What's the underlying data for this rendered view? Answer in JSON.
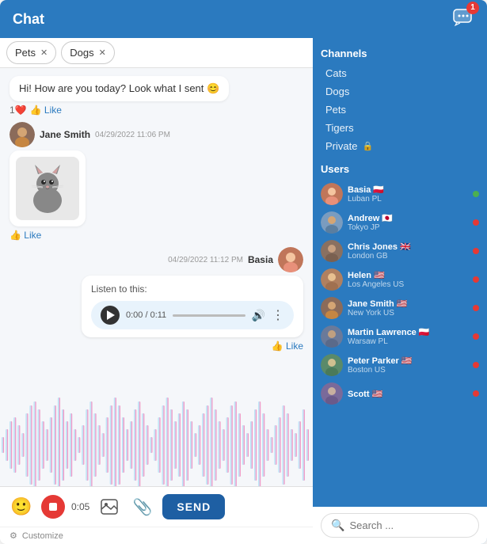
{
  "header": {
    "title": "Chat",
    "notification_count": "1"
  },
  "tabs": [
    {
      "label": "Pets",
      "active": true
    },
    {
      "label": "Dogs",
      "active": false
    }
  ],
  "channels": {
    "section_title": "Channels",
    "items": [
      {
        "name": "Cats",
        "icon": ""
      },
      {
        "name": "Dogs",
        "icon": ""
      },
      {
        "name": "Pets",
        "icon": ""
      },
      {
        "name": "Tigers",
        "icon": ""
      },
      {
        "name": "Private",
        "icon": "🔒"
      }
    ]
  },
  "users": {
    "section_title": "Users",
    "items": [
      {
        "name": "Basia",
        "flag": "🇵🇱",
        "location": "Luban PL",
        "status": "online"
      },
      {
        "name": "Andrew",
        "flag": "🇯🇵",
        "location": "Tokyo JP",
        "status": "offline"
      },
      {
        "name": "Chris Jones",
        "flag": "🇬🇧",
        "location": "London GB",
        "status": "offline"
      },
      {
        "name": "Helen",
        "flag": "🇺🇸",
        "location": "Los Angeles US",
        "status": "offline"
      },
      {
        "name": "Jane Smith",
        "flag": "🇺🇸",
        "location": "New York US",
        "status": "offline"
      },
      {
        "name": "Martin Lawrence",
        "flag": "🇵🇱",
        "location": "Warsaw PL",
        "status": "offline"
      },
      {
        "name": "Peter Parker",
        "flag": "🇺🇸",
        "location": "Boston US",
        "status": "offline"
      },
      {
        "name": "Scott",
        "flag": "🇺🇸",
        "location": "",
        "status": "offline"
      }
    ]
  },
  "messages": [
    {
      "id": "msg1",
      "type": "incoming_text",
      "sender": "",
      "time": "",
      "text": "Hi! How are you today? Look what I sent",
      "emoji": "😊",
      "reactions": [
        {
          "type": "heart",
          "count": 1
        }
      ],
      "like": true
    },
    {
      "id": "msg2",
      "type": "incoming_image",
      "sender": "Jane Smith",
      "time": "04/29/2022 11:06 PM",
      "image": "cat",
      "like": true
    },
    {
      "id": "msg3",
      "type": "outgoing_audio",
      "sender": "Basia",
      "time": "04/29/2022 11:12 PM",
      "audio_label": "Listen to this:",
      "audio_time": "0:00 / 0:11",
      "like": true
    }
  ],
  "input": {
    "timer": "0:05",
    "send_label": "SEND"
  },
  "customize": {
    "label": "Customize"
  },
  "search": {
    "placeholder": "Search ..."
  }
}
